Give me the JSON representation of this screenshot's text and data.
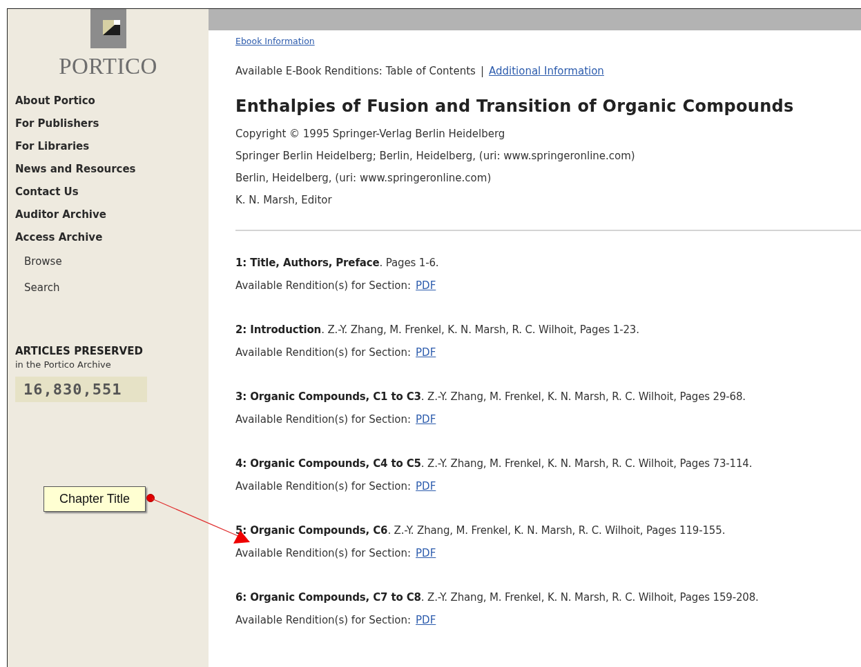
{
  "sidebar": {
    "logo": {
      "text": "PORTICO"
    },
    "nav": [
      {
        "label": "About Portico",
        "kind": "main"
      },
      {
        "label": "For Publishers",
        "kind": "main"
      },
      {
        "label": "For Libraries",
        "kind": "main"
      },
      {
        "label": "News and Resources",
        "kind": "main"
      },
      {
        "label": "Contact Us",
        "kind": "main"
      },
      {
        "label": "Auditor Archive",
        "kind": "main"
      },
      {
        "label": "Access Archive",
        "kind": "main"
      },
      {
        "label": "Browse",
        "kind": "sub"
      },
      {
        "label": "Search",
        "kind": "sub"
      }
    ],
    "counter": {
      "heading": "ARTICLES PRESERVED",
      "subheading": "in the Portico Archive",
      "value": "16,830,551"
    }
  },
  "main": {
    "top_link": "Ebook Information",
    "renditions": {
      "label": "Available E-Book Renditions: Table of Contents",
      "separator": "|",
      "link": "Additional Information"
    },
    "title": "Enthalpies of Fusion and Transition of Organic Compounds",
    "details": [
      "Copyright © 1995 Springer-Verlag Berlin Heidelberg",
      "Springer Berlin Heidelberg; Berlin, Heidelberg, (uri: www.springeronline.com)",
      "Berlin, Heidelberg, (uri: www.springeronline.com)",
      "K. N. Marsh, Editor"
    ],
    "sections": [
      {
        "heading": "**1: Title, Authors, Preface**. Pages 1-6.",
        "rendition_label": "Available Rendition(s) for Section:",
        "link": "PDF"
      },
      {
        "heading": "**2: Introduction**. Z.-Y. Zhang, M. Frenkel, K. N. Marsh, R. C. Wilhoit, Pages 1-23.",
        "rendition_label": "Available Rendition(s) for Section:",
        "link": "PDF"
      },
      {
        "heading": "**3: Organic Compounds, C1 to C3**. Z.-Y. Zhang, M. Frenkel, K. N. Marsh, R. C. Wilhoit, Pages 29-68.",
        "rendition_label": "Available Rendition(s) for Section:",
        "link": "PDF"
      },
      {
        "heading": "**4: Organic Compounds, C4 to C5**. Z.-Y. Zhang, M. Frenkel, K. N. Marsh, R. C. Wilhoit, Pages 73-114.",
        "rendition_label": "Available Rendition(s) for Section:",
        "link": "PDF"
      },
      {
        "heading": "**5: Organic Compounds, C6**. Z.-Y. Zhang, M. Frenkel, K. N. Marsh, R. C. Wilhoit, Pages 119-155.",
        "rendition_label": "Available Rendition(s) for Section:",
        "link": "PDF"
      },
      {
        "heading": "**6: Organic Compounds, C7 to C8**. Z.-Y. Zhang, M. Frenkel, K. N. Marsh, R. C. Wilhoit, Pages 159-208.",
        "rendition_label": "Available Rendition(s) for Section:",
        "link": "PDF"
      }
    ]
  },
  "callout": {
    "text": "Chapter Title"
  }
}
